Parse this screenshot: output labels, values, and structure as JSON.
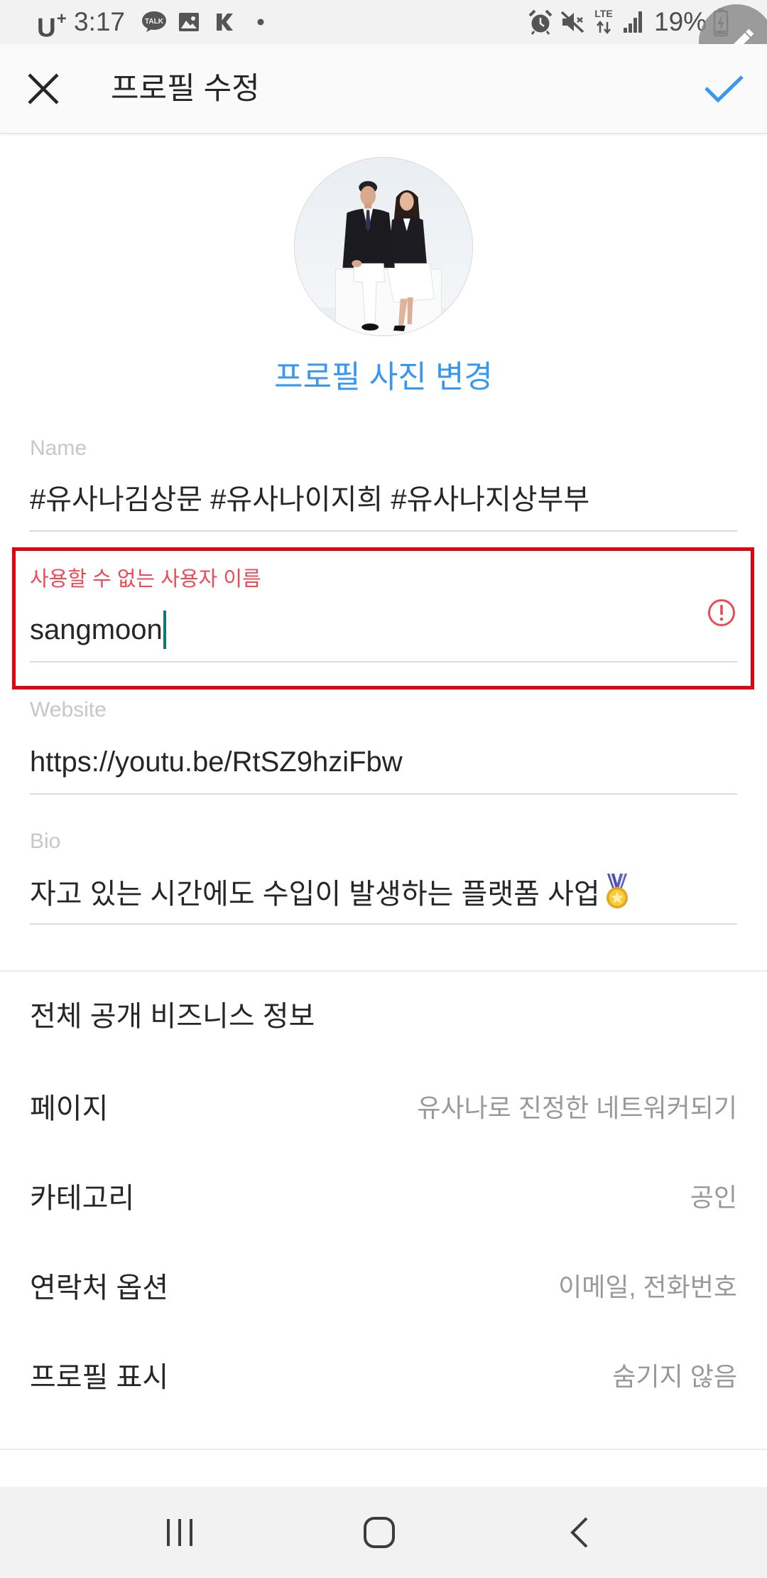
{
  "status_bar": {
    "carrier": {
      "name": "U",
      "suffix": "+"
    },
    "time": "3:17",
    "notification_icons": [
      "kakaotalk-icon",
      "gallery-icon",
      "kakaostory-icon",
      "more-notifications-dot-icon"
    ],
    "kakaotalk_label": "TALK",
    "system_icons": [
      "alarm-icon",
      "mute-icon",
      "lte-data-icon",
      "signal-strength-icon",
      "battery-charging-icon"
    ],
    "network_type": "LTE",
    "battery_percent": "19%",
    "battery_level": 0.19
  },
  "floating_edit_button": {
    "icon": "pencil-icon"
  },
  "header": {
    "title": "프로필 수정",
    "close_icon": "close-icon",
    "confirm_icon": "check-icon"
  },
  "profile_photo": {
    "change_label": "프로필 사진 변경"
  },
  "fields": {
    "name": {
      "label": "Name",
      "value": "#유사나김상문 #유사나이지희 #유사나지상부부"
    },
    "username": {
      "error_message": "사용할 수 없는 사용자 이름",
      "value": "sangmoon",
      "status_icon": "error-alert-icon",
      "focused": true
    },
    "website": {
      "label": "Website",
      "value": "https://youtu.be/RtSZ9hziFbw"
    },
    "bio": {
      "label": "Bio",
      "value": "자고 있는 시간에도 수입이 발생하는 플랫폼 사업",
      "trailing_emoji_icon": "sports-medal-icon"
    }
  },
  "business_info": {
    "section_title": "전체 공개 비즈니스 정보",
    "rows": [
      {
        "label": "페이지",
        "value": "유사나로 진정한 네트워커되기"
      },
      {
        "label": "카테고리",
        "value": "공인"
      },
      {
        "label": "연락처 옵션",
        "value": "이메일, 전화번호"
      },
      {
        "label": "프로필 표시",
        "value": "숨기지 않음"
      }
    ]
  },
  "nav_bar": {
    "icons": [
      "recent-apps-icon",
      "home-icon",
      "back-icon"
    ]
  },
  "colors": {
    "accent": "#3897f0",
    "error": "#ed4956",
    "highlight_box": "#e3000f",
    "cursor": "#0d7b70",
    "label": "#c7c7c7",
    "divider": "#dbdbdb",
    "secondary_text": "#999999",
    "text": "#262626"
  }
}
